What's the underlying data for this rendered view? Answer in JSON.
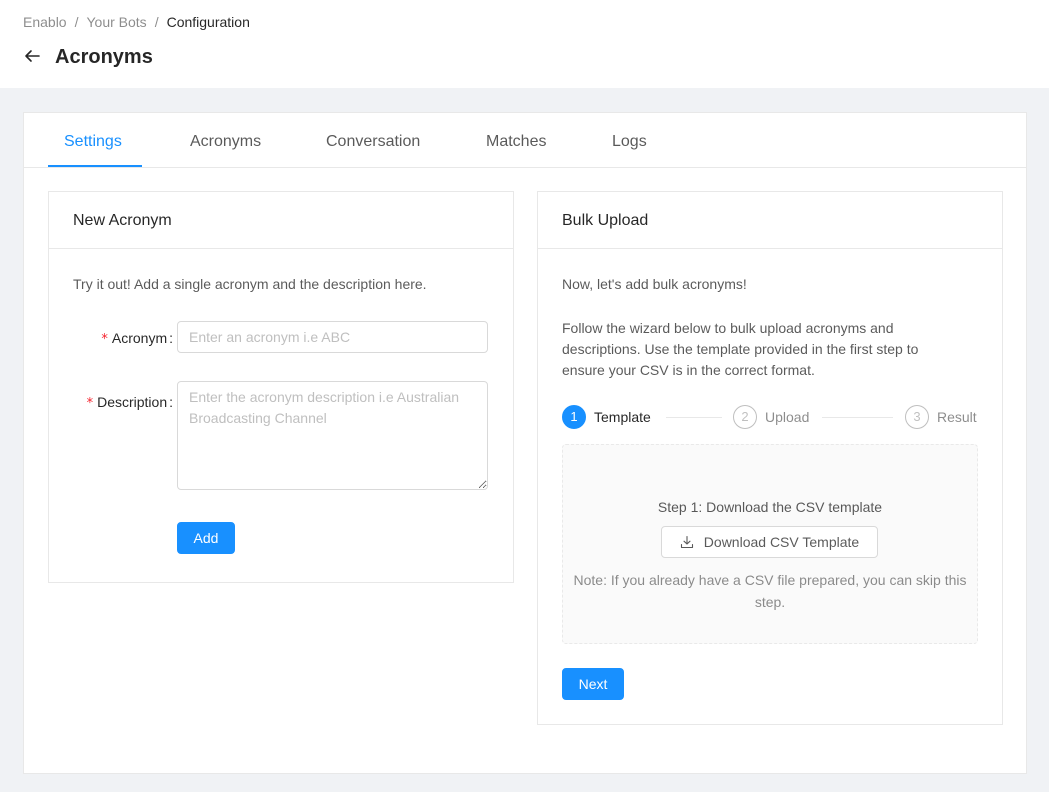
{
  "breadcrumb": {
    "items": [
      "Enablo",
      "Your Bots",
      "Configuration"
    ],
    "separator": "/"
  },
  "header": {
    "back_icon": "arrow-left-icon",
    "title": "Acronyms"
  },
  "tabs": [
    {
      "label": "Settings",
      "active": true
    },
    {
      "label": "Acronyms",
      "active": false
    },
    {
      "label": "Conversation",
      "active": false
    },
    {
      "label": "Matches",
      "active": false
    },
    {
      "label": "Logs",
      "active": false
    }
  ],
  "new_acronym": {
    "title": "New Acronym",
    "intro": "Try it out! Add a single acronym and the description here.",
    "acronym_label": "Acronym",
    "acronym_placeholder": "Enter an acronym i.e ABC",
    "acronym_value": "",
    "description_label": "Description",
    "description_placeholder": "Enter the acronym description i.e Australian Broadcasting Channel",
    "description_value": "",
    "required_mark": "*",
    "colon": ":",
    "add_label": "Add"
  },
  "bulk_upload": {
    "title": "Bulk Upload",
    "intro": "Now, let's add bulk acronyms!",
    "instructions": "Follow the wizard below to bulk upload acronyms and descriptions. Use the template provided in the first step to ensure your CSV is in the correct format.",
    "steps": [
      {
        "number": "1",
        "title": "Template",
        "status": "process"
      },
      {
        "number": "2",
        "title": "Upload",
        "status": "wait"
      },
      {
        "number": "3",
        "title": "Result",
        "status": "wait"
      }
    ],
    "step_heading": "Step 1: Download the CSV template",
    "download_icon": "download-icon",
    "download_label": "Download CSV Template",
    "note": "Note: If you already have a CSV file prepared, you can skip this step.",
    "next_label": "Next"
  },
  "colors": {
    "primary": "#1890ff",
    "required": "#f5222d",
    "background": "#f0f2f5"
  }
}
